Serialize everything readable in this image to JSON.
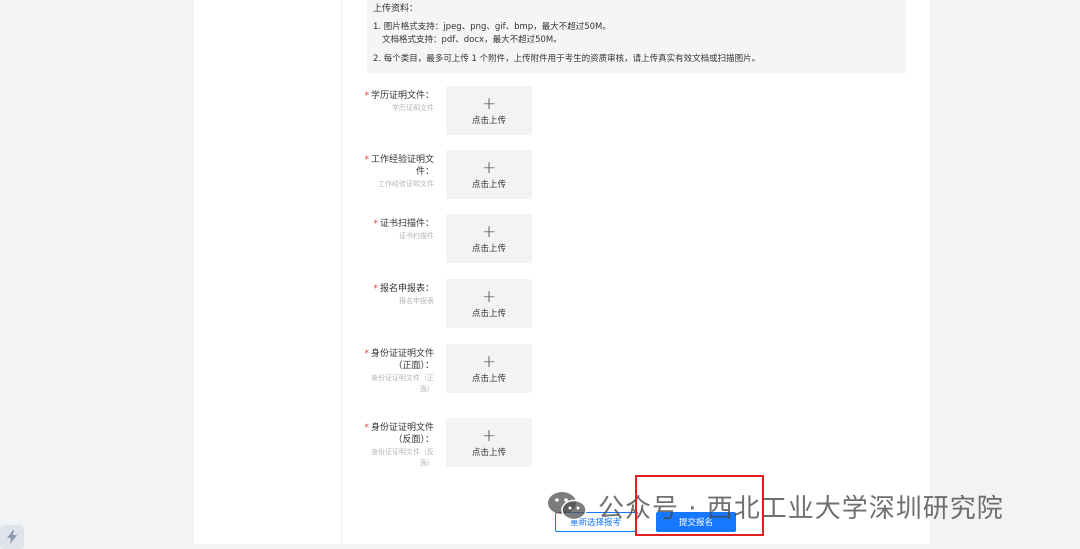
{
  "notice": {
    "title": "上传资料：",
    "line1": "1. 图片格式支持：jpeg、png、gif、bmp，最大不超过50M。",
    "line2": "文档格式支持：pdf、docx，最大不超过50M。",
    "line3": "2. 每个类目，最多可上传 1 个附件，上传附件用于考生的资质审核，请上传真实有效文档或扫描图片。"
  },
  "uploads": [
    {
      "label": "学历证明文件：",
      "sub": "学历证明文件",
      "plus": "+",
      "button": "点击上传"
    },
    {
      "label_line1": "工作经验证明文",
      "label_line2": "件：",
      "sub": "工作经验证明文件",
      "plus": "+",
      "button": "点击上传"
    },
    {
      "label": "证书扫描件：",
      "sub": "证书扫描件",
      "plus": "+",
      "button": "点击上传"
    },
    {
      "label": "报名申报表：",
      "sub": "报名申报表",
      "plus": "+",
      "button": "点击上传"
    },
    {
      "label_line1": "身份证证明文件",
      "label_line2": "（正面）：",
      "sub_line1": "身份证证明文件（正",
      "sub_line2": "面）",
      "plus": "+",
      "button": "点击上传"
    },
    {
      "label_line1": "身份证证明文件",
      "label_line2": "（反面）：",
      "sub_line1": "身份证证明文件（反",
      "sub_line2": "面）",
      "plus": "+",
      "button": "点击上传"
    }
  ],
  "required_mark": "*",
  "actions": {
    "reselect": "重新选择报考",
    "submit": "提交报名"
  },
  "watermark": "公众号 · 西北工业大学深圳研究院",
  "colors": {
    "primary": "#1677ff",
    "required": "#e53935",
    "highlight": "#e02020"
  }
}
